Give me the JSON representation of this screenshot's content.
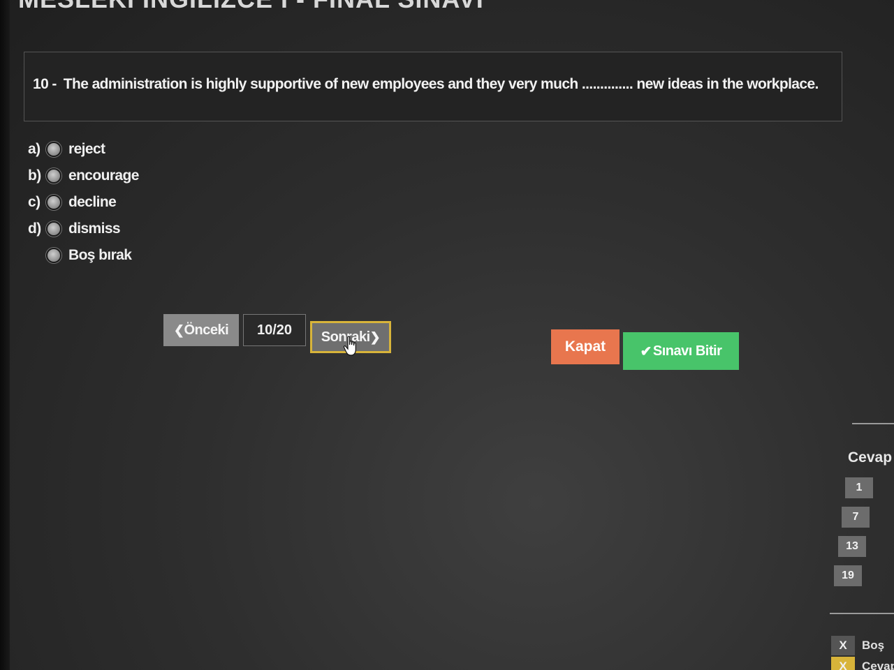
{
  "exam": {
    "title": "MESLEKİ İNGİLİZCE I - FİNAL SINAVI"
  },
  "question": {
    "number": "10 -",
    "text": "The administration is highly supportive of new employees and they very much .............. new ideas in the workplace."
  },
  "options": [
    {
      "letter": "a)",
      "label": "reject"
    },
    {
      "letter": "b)",
      "label": "encourage"
    },
    {
      "letter": "c)",
      "label": "decline"
    },
    {
      "letter": "d)",
      "label": "dismiss"
    },
    {
      "letter": "",
      "label": "Boş bırak"
    }
  ],
  "navigation": {
    "prev_label": "Önceki",
    "page_indicator": "10/20",
    "next_label": "Sonraki"
  },
  "actions": {
    "close_label": "Kapat",
    "finish_label": "Sınavı Bitir"
  },
  "answer_panel": {
    "title": "Cevap",
    "numbers": [
      "1",
      "7",
      "13",
      "19"
    ]
  },
  "legend": [
    {
      "mark": "X",
      "label": "Boş"
    },
    {
      "mark": "X",
      "label": "Cevap"
    }
  ],
  "colors": {
    "close_button": "#e8764e",
    "finish_button": "#48c46a",
    "next_highlight": "#d8b43a"
  },
  "icons": {
    "prev": "chevron-left-icon",
    "next": "chevron-right-icon",
    "finish": "check-icon",
    "cursor": "hand-pointer-icon"
  }
}
